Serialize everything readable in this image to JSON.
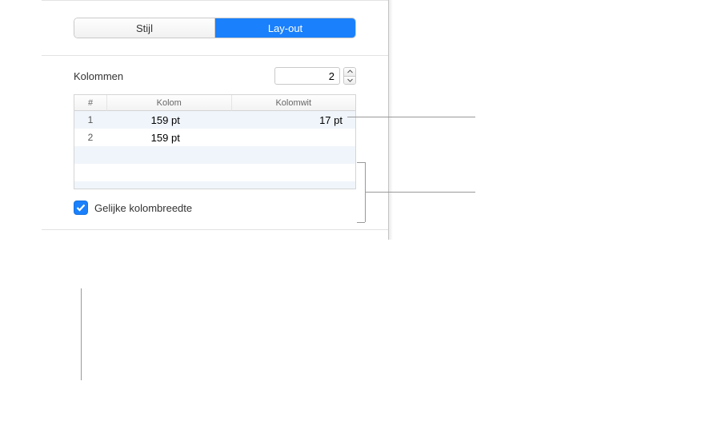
{
  "tabs": {
    "style": "Stijl",
    "layout": "Lay-out"
  },
  "columns": {
    "label": "Kolommen",
    "value": "2",
    "table": {
      "headers": {
        "num": "#",
        "kolom": "Kolom",
        "kolomwit": "Kolomwit"
      },
      "rows": [
        {
          "num": "1",
          "kolom": "159 pt",
          "kolomwit": "17 pt"
        },
        {
          "num": "2",
          "kolom": "159 pt",
          "kolomwit": ""
        }
      ]
    },
    "equalWidthLabel": "Gelijke kolombreedte"
  }
}
